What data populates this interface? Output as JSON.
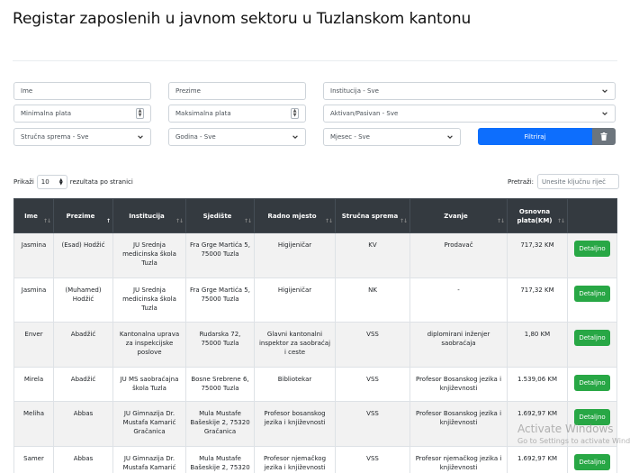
{
  "title": "Registar zaposlenih u javnom sektoru u Tuzlanskom kantonu",
  "filters": {
    "ime_placeholder": "Ime",
    "prezime_placeholder": "Prezime",
    "institucija": "Institucija - Sve",
    "min_plata_placeholder": "Minimalna plata",
    "max_plata_placeholder": "Maksimalna plata",
    "status": "Aktivan/Pasivan - Sve",
    "strucna_sprema": "Stručna sprema - Sve",
    "godina": "Godina - Sve",
    "mjesec": "Mjesec - Sve",
    "filter_button": "Filtriraj",
    "clear_icon": "trash-icon"
  },
  "table_controls": {
    "show_label": "Prikaži",
    "page_length": "10",
    "per_page_label": "rezultata po stranici",
    "search_label": "Pretraži:",
    "search_placeholder": "Unesite ključnu riječ"
  },
  "table": {
    "headers": [
      "Ime",
      "Prezime",
      "Institucija",
      "Sjedište",
      "Radno mjesto",
      "Stručna sprema",
      "Zvanje",
      "Osnovna plata(KM)",
      ""
    ],
    "detail_label": "Detaljno",
    "rows": [
      [
        "Jasmina",
        "(Esad) Hodžić",
        "JU Srednja medicinska škola Tuzla",
        "Fra Grge Martića 5, 75000 Tuzla",
        "Higijeničar",
        "KV",
        "Prodavač",
        "717,32 KM"
      ],
      [
        "Jasmina",
        "(Muhamed) Hodžić",
        "JU Srednja medicinska škola Tuzla",
        "Fra Grge Martića 5, 75000 Tuzla",
        "Higijeničar",
        "NK",
        "-",
        "717,32 KM"
      ],
      [
        "Enver",
        "Abadžić",
        "Kantonalna uprava za inspekcijske poslove",
        "Rudarska 72, 75000 Tuzla",
        "Glavni kantonalni inspektor za saobraćaj i ceste",
        "VSS",
        "diplomirani inženjer saobraćaja",
        "1,80 KM"
      ],
      [
        "Mirela",
        "Abadžić",
        "JU MS saobraćajna škola Tuzla",
        "Bosne Srebrene 6, 75000 Tuzla",
        "Bibliotekar",
        "VSS",
        "Profesor Bosanskog jezika i književnosti",
        "1.539,06 KM"
      ],
      [
        "Meliha",
        "Abbas",
        "JU Gimnazija Dr. Mustafa Kamarić Gračanica",
        "Mula Mustafe Bašeskije 2, 75320 Gračanica",
        "Profesor bosanskog jezika i književnosti",
        "VSS",
        "Profesor Bosanskog jezika i književnosti",
        "1.692,97 KM"
      ],
      [
        "Samer",
        "Abbas",
        "JU Gimnazija Dr. Mustafa Kamarić Gračanica",
        "Mula Mustafe Bašeskije 2, 75320",
        "Profesor njemačkog jezika i književnosti",
        "VSS",
        "Profesor njemačkog jezika i književnosti",
        "1.692,97 KM"
      ]
    ]
  },
  "watermark": {
    "line1": "Activate Windows",
    "line2": "Go to Settings to activate Windows."
  },
  "colors": {
    "primary": "#0d6efd",
    "secondary": "#6c757d",
    "success": "#28a745",
    "table_header": "#343a40"
  }
}
